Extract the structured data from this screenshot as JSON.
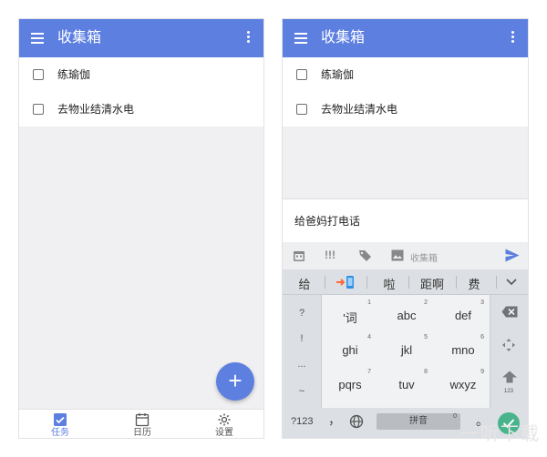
{
  "left_screen": {
    "app_bar": {
      "title": "收集箱",
      "menu_icon": "hamburger-icon",
      "more_icon": "more-vert-icon"
    },
    "tasks": [
      {
        "label": "练瑜伽"
      },
      {
        "label": "去物业结清水电"
      }
    ],
    "fab_icon": "plus-icon",
    "bottom_nav": [
      {
        "label": "任务",
        "icon": "checkbox-icon",
        "active": true
      },
      {
        "label": "日历",
        "icon": "calendar-icon",
        "active": false
      },
      {
        "label": "设置",
        "icon": "gear-icon",
        "active": false
      }
    ]
  },
  "right_screen": {
    "app_bar": {
      "title": "收集箱"
    },
    "tasks": [
      {
        "label": "练瑜伽"
      },
      {
        "label": "去物业结清水电"
      }
    ],
    "quick_add": {
      "input_value": "给爸妈打电话",
      "priority_label": "!!!",
      "list_label": "收集箱"
    },
    "keyboard": {
      "candidates": [
        "给",
        "啦",
        "距啊",
        "费"
      ],
      "side_left": [
        "?",
        "!",
        "...",
        "~"
      ],
      "keys": [
        {
          "label": "'词",
          "num": "1"
        },
        {
          "label": "abc",
          "num": "2"
        },
        {
          "label": "def",
          "num": "3"
        },
        {
          "label": "ghi",
          "num": "4"
        },
        {
          "label": "jkl",
          "num": "5"
        },
        {
          "label": "mno",
          "num": "6"
        },
        {
          "label": "pqrs",
          "num": "7"
        },
        {
          "label": "tuv",
          "num": "8"
        },
        {
          "label": "wxyz",
          "num": "9"
        }
      ],
      "shift_hint": "123",
      "bottom": {
        "num_key": "?123",
        "comma": "，",
        "space_label": "拼音",
        "zero": "0",
        "period": "。"
      }
    }
  },
  "watermark": "一听下载",
  "colors": {
    "primary": "#5c7fe0",
    "accept": "#49b48c",
    "keyboard_bg": "#dcdfe3"
  }
}
